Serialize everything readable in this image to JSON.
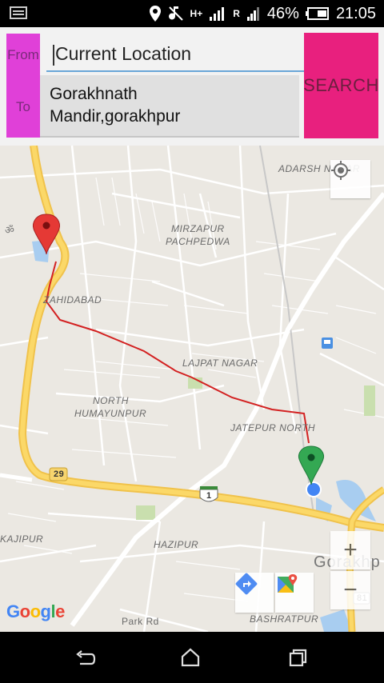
{
  "status_bar": {
    "network_type": "H+",
    "roaming": "R",
    "battery": "46%",
    "time": "21:05"
  },
  "route_form": {
    "from_label": "From",
    "from_value": "Current Location",
    "to_label": "To",
    "to_value_line1": "Gorakhnath",
    "to_value_line2": "Mandir,gorakhpur",
    "search_label": "SEARCH"
  },
  "map": {
    "labels": {
      "adarsh_nagar": "ADARSH NAGAR",
      "mirzapur": "MIRZAPUR",
      "pachpedwa": "PACHPEDWA",
      "zahidabad": "ZAHIDABAD",
      "lajpat_nagar": "LAJPAT NAGAR",
      "north": "NORTH",
      "humayunpur": "HUMAYUNPUR",
      "jatepur_north": "JATEPUR NORTH",
      "kajipur": "KAJIPUR",
      "hazipur": "HAZIPUR",
      "gorakhpur": "Gorakhp",
      "bashratpur": "BASHRATPUR",
      "park_rd": "Park Rd",
      "route_29": "29",
      "route_1": "1",
      "route_81": "81"
    },
    "zoom_in_label": "+",
    "zoom_out_label": "−",
    "google_logo": "Google",
    "colors": {
      "route_line": "#d32222",
      "major_road": "#f6cf5a",
      "origin_marker": "#e53935",
      "destination_marker": "#34a853",
      "current_location_dot": "#4285f4"
    }
  },
  "icons": {
    "status_left": "keyboard-icon",
    "location": "location-pin-icon",
    "silent": "silent-mode-icon",
    "signal": "signal-icon",
    "battery": "battery-icon",
    "locate": "my-location-icon",
    "directions": "directions-icon",
    "google_maps": "google-maps-icon",
    "back": "back-icon",
    "home": "home-icon",
    "recents": "recents-icon"
  }
}
